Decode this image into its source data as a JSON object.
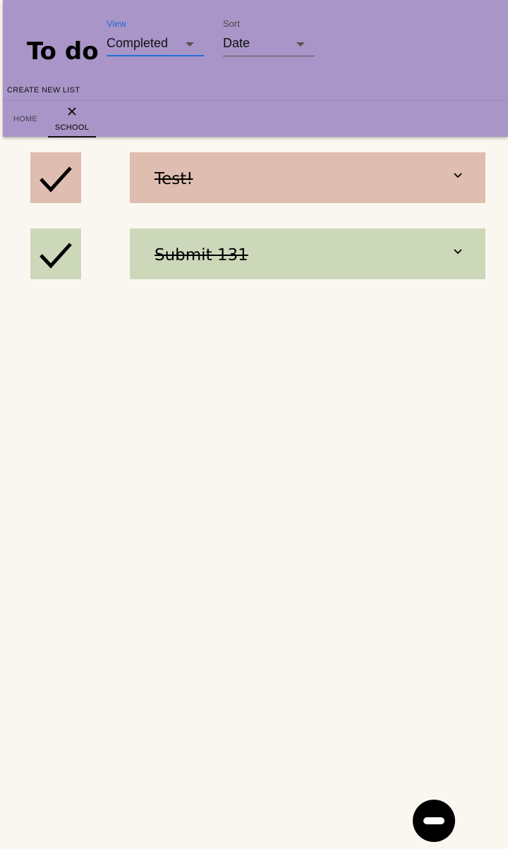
{
  "header": {
    "title": "To do",
    "view": {
      "label": "View",
      "value": "Completed"
    },
    "sort": {
      "label": "Sort",
      "value": "Date"
    },
    "create_list_label": "CREATE NEW LIST"
  },
  "tabs": [
    {
      "label": "HOME",
      "selected": false
    },
    {
      "label": "SCHOOL",
      "selected": true,
      "icon": "close-icon"
    }
  ],
  "tasks": [
    {
      "text": "Test!",
      "completed": true,
      "color": "#dfbdb0",
      "icon": "checkmark-icon"
    },
    {
      "text": "Submit 131",
      "completed": true,
      "color": "#cdd8bb",
      "icon": "checkmark-icon"
    }
  ],
  "fab": {
    "icon": "minus-circle-icon"
  },
  "colors": {
    "appbar": "#a995c7",
    "background": "#faf7f0",
    "accent": "#1f6fd6"
  }
}
